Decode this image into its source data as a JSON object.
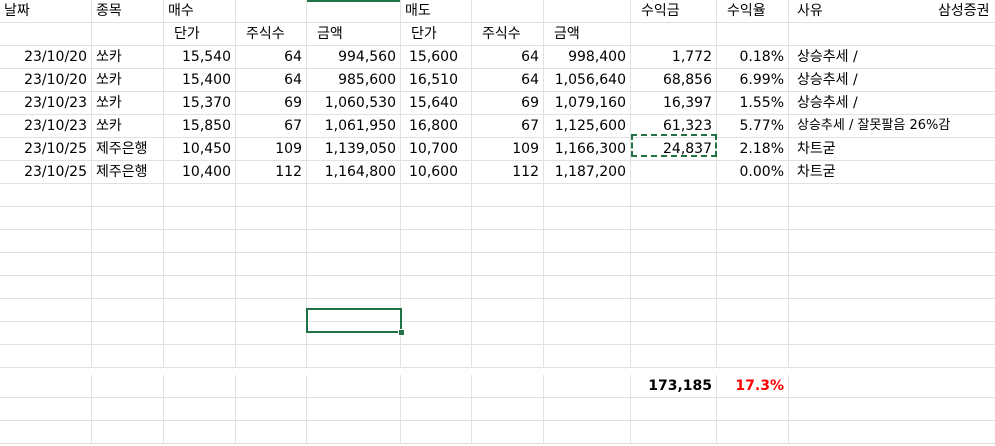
{
  "header1": {
    "date": "날짜",
    "stock": "종목",
    "buy": "매수",
    "sell": "매도",
    "profit": "수익금",
    "rate": "수익율",
    "reason": "사유",
    "extra": "삼성증권"
  },
  "header2": {
    "buy_price": "단가",
    "buy_qty": "주식수",
    "buy_amount": "금액",
    "sell_price": "단가",
    "sell_qty": "주식수",
    "sell_amount": "금액"
  },
  "rows": [
    {
      "date": "23/10/20",
      "stock": "쏘카",
      "buy_price": "15,540",
      "buy_qty": "64",
      "buy_amount": "994,560",
      "sell_price": "15,600",
      "sell_qty": "64",
      "sell_amount": "998,400",
      "profit": "1,772",
      "rate": "0.18%",
      "reason": "상승추세 /"
    },
    {
      "date": "23/10/20",
      "stock": "쏘카",
      "buy_price": "15,400",
      "buy_qty": "64",
      "buy_amount": "985,600",
      "sell_price": "16,510",
      "sell_qty": "64",
      "sell_amount": "1,056,640",
      "profit": "68,856",
      "rate": "6.99%",
      "reason": "상승추세 /"
    },
    {
      "date": "23/10/23",
      "stock": "쏘카",
      "buy_price": "15,370",
      "buy_qty": "69",
      "buy_amount": "1,060,530",
      "sell_price": "15,640",
      "sell_qty": "69",
      "sell_amount": "1,079,160",
      "profit": "16,397",
      "rate": "1.55%",
      "reason": "상승추세 /"
    },
    {
      "date": "23/10/23",
      "stock": "쏘카",
      "buy_price": "15,850",
      "buy_qty": "67",
      "buy_amount": "1,061,950",
      "sell_price": "16,800",
      "sell_qty": "67",
      "sell_amount": "1,125,600",
      "profit": "61,323",
      "rate": "5.77%",
      "reason": "상승추세 / 잘못팔음 26%감"
    },
    {
      "date": "23/10/25",
      "stock": "제주은행",
      "buy_price": "10,450",
      "buy_qty": "109",
      "buy_amount": "1,139,050",
      "sell_price": "10,700",
      "sell_qty": "109",
      "sell_amount": "1,166,300",
      "profit": "24,837",
      "rate": "2.18%",
      "reason": "차트굳"
    },
    {
      "date": "23/10/25",
      "stock": "제주은행",
      "buy_price": "10,400",
      "buy_qty": "112",
      "buy_amount": "1,164,800",
      "sell_price": "10,600",
      "sell_qty": "112",
      "sell_amount": "1,187,200",
      "profit": "",
      "rate": "0.00%",
      "reason": "차트굳"
    }
  ],
  "totals": {
    "profit": "173,185",
    "rate": "17.3%"
  },
  "colors": {
    "accent": "#217346",
    "negative_rate": "#ff0000",
    "gridline": "#e1e1e1"
  }
}
